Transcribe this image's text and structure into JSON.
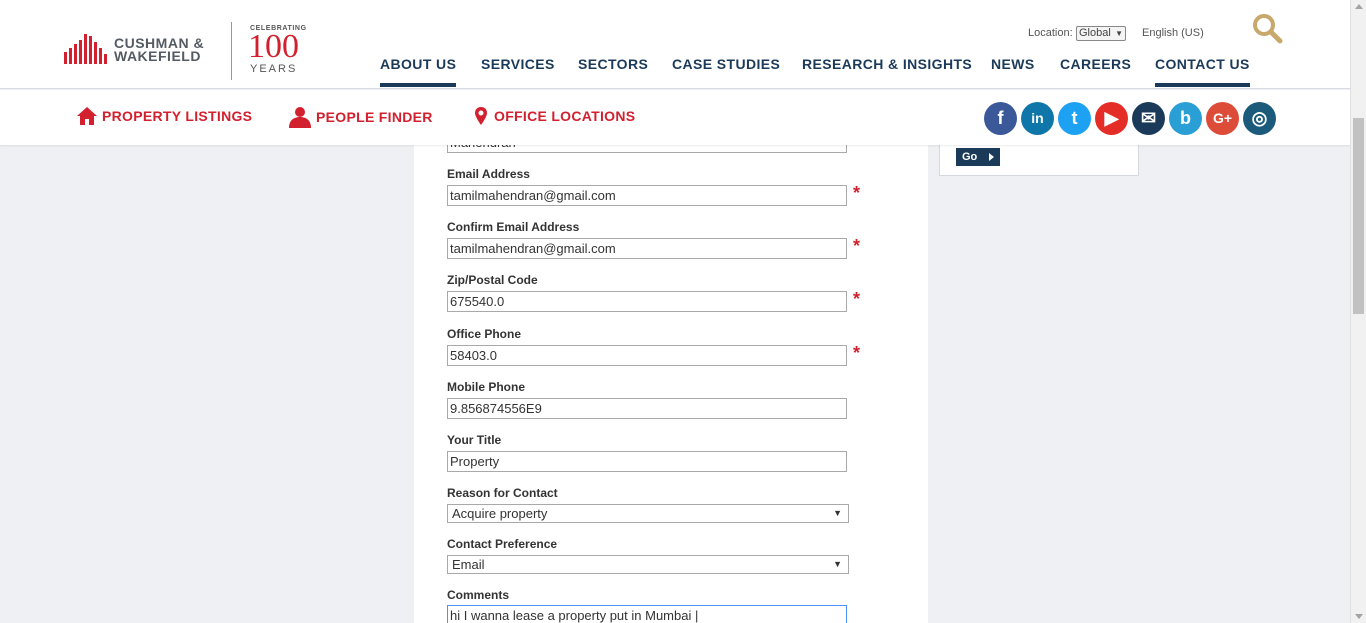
{
  "brand": {
    "logo_line1": "CUSHMAN &",
    "logo_line2": "WAKEFIELD",
    "celebrating": "CELEBRATING",
    "anniversary_number": "100",
    "anniversary_unit": "YEARS"
  },
  "utility": {
    "location_label": "Location:",
    "location_value": "Global",
    "language": "English (US)"
  },
  "nav": [
    {
      "label": "ABOUT US"
    },
    {
      "label": "SERVICES"
    },
    {
      "label": "SECTORS"
    },
    {
      "label": "CASE STUDIES"
    },
    {
      "label": "RESEARCH & INSIGHTS"
    },
    {
      "label": "NEWS"
    },
    {
      "label": "CAREERS"
    },
    {
      "label": "CONTACT US"
    }
  ],
  "subnav": {
    "property_listings": "PROPERTY LISTINGS",
    "people_finder": "PEOPLE FINDER",
    "office_locations": "OFFICE LOCATIONS"
  },
  "social": [
    {
      "name": "facebook-icon",
      "glyph": "f",
      "color": "#3b5998"
    },
    {
      "name": "linkedin-icon",
      "glyph": "in",
      "color": "#0e76a8"
    },
    {
      "name": "twitter-icon",
      "glyph": "t",
      "color": "#1da1f2"
    },
    {
      "name": "youtube-icon",
      "glyph": "▶",
      "color": "#e52d27"
    },
    {
      "name": "email-icon",
      "glyph": "✉",
      "color": "#1b3a5a"
    },
    {
      "name": "blog-icon",
      "glyph": "b",
      "color": "#2a9fd6"
    },
    {
      "name": "google-plus-icon",
      "glyph": "G+",
      "color": "#dd4b39"
    },
    {
      "name": "instagram-icon",
      "glyph": "◎",
      "color": "#1b5a7a"
    }
  ],
  "sidebar": {
    "go_label": "Go"
  },
  "form": {
    "last_name_value": "Mahendran",
    "email_label": "Email Address",
    "email_value": "tamilmahendran@gmail.com",
    "confirm_email_label": "Confirm Email Address",
    "confirm_email_value": "tamilmahendran@gmail.com",
    "zip_label": "Zip/Postal Code",
    "zip_value": "675540.0",
    "office_phone_label": "Office Phone",
    "office_phone_value": "58403.0",
    "mobile_phone_label": "Mobile Phone",
    "mobile_phone_value": "9.856874556E9",
    "title_label": "Your Title",
    "title_value": "Property",
    "reason_label": "Reason for Contact",
    "reason_value": "Acquire property",
    "preference_label": "Contact Preference",
    "preference_value": "Email",
    "comments_label": "Comments",
    "comments_value": "hi I wanna lease a property put in Mumbai |",
    "required_marker": "*"
  },
  "colors": {
    "brand_red": "#d3202f",
    "brand_navy": "#1b3a5a"
  }
}
